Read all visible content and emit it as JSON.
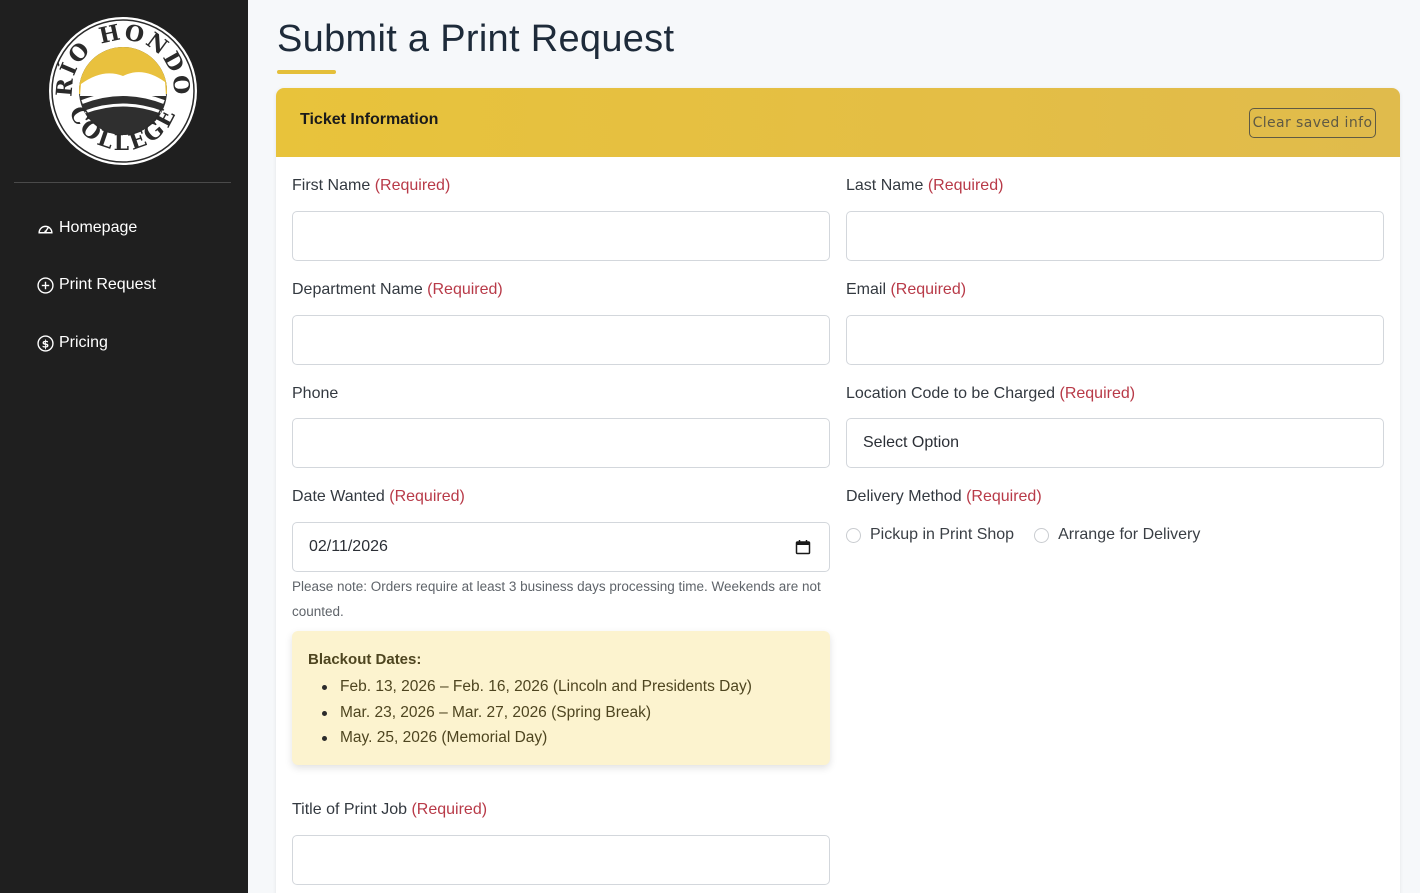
{
  "sidebar": {
    "logo_text": "RÍO HONDO COLLEGE",
    "items": [
      {
        "label": "Homepage",
        "icon": "speedometer-icon"
      },
      {
        "label": "Print Request",
        "icon": "plus-circle-icon"
      },
      {
        "label": "Pricing",
        "icon": "dollar-circle-icon"
      }
    ]
  },
  "page": {
    "title": "Submit a Print Request"
  },
  "card": {
    "header_title": "Ticket Information",
    "clear_button": "Clear saved info"
  },
  "form": {
    "required_tag": "(Required)",
    "first_name": {
      "label": "First Name",
      "value": ""
    },
    "last_name": {
      "label": "Last Name",
      "value": ""
    },
    "department": {
      "label": "Department Name",
      "value": ""
    },
    "email": {
      "label": "Email",
      "value": ""
    },
    "phone": {
      "label": "Phone",
      "value": ""
    },
    "location_code": {
      "label": "Location Code to be Charged",
      "value": "Select Option"
    },
    "date_wanted": {
      "label": "Date Wanted",
      "value": "02/11/2026"
    },
    "delivery_method": {
      "label": "Delivery Method",
      "options": [
        "Pickup in Print Shop",
        "Arrange for Delivery"
      ]
    },
    "note": "Please note: Orders require at least 3 business days processing time. Weekends are not counted.",
    "blackout": {
      "title": "Blackout Dates:",
      "items": [
        "Feb. 13, 2026 – Feb. 16, 2026 (Lincoln and Presidents Day)",
        "Mar. 23, 2026 – Mar. 27, 2026 (Spring Break)",
        "May. 25, 2026 (Memorial Day)"
      ]
    },
    "job_title": {
      "label": "Title of Print Job",
      "value": ""
    }
  },
  "colors": {
    "sidebar_bg": "#1f1f1f",
    "accent_gold": "#e8c33b",
    "required_red": "#b83a48",
    "blackout_bg": "#fcf3cf"
  }
}
